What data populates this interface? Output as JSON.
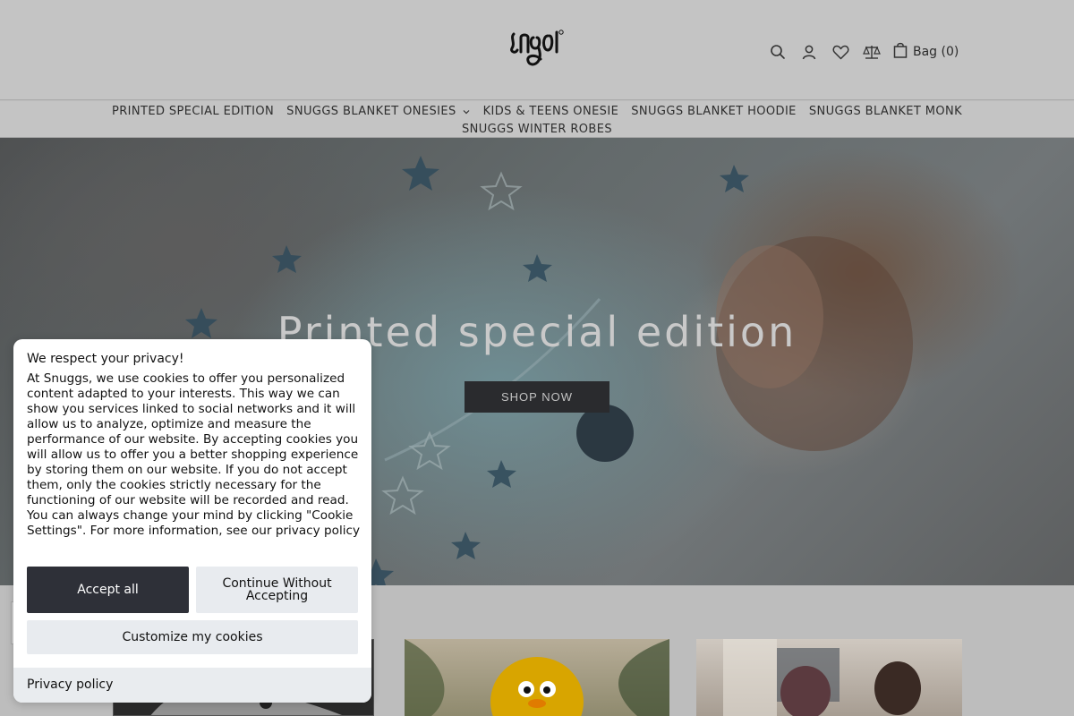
{
  "header": {
    "logo_text": "snugs",
    "bag_label": "Bag (0)",
    "icons": [
      "search-icon",
      "user-icon",
      "heart-icon",
      "compare-scale-icon",
      "shopping-bag-icon"
    ]
  },
  "nav": {
    "items": [
      {
        "label": "PRINTED SPECIAL EDITION"
      },
      {
        "label": "SNUGGS BLANKET ONESIES",
        "has_dropdown": true
      },
      {
        "label": "KIDS & TEENS ONESIE"
      },
      {
        "label": "SNUGGS BLANKET HOODIE"
      },
      {
        "label": "SNUGGS BLANKET MONK"
      },
      {
        "label": "SNUGGS WINTER ROBES"
      }
    ]
  },
  "hero": {
    "title": "Printed special edition",
    "cta": "SHOP NOW"
  },
  "cookie": {
    "title": "We respect your privacy!",
    "body": "At Snuggs, we use cookies to offer you personalized content adapted to your interests. This way we can show you services linked to social networks and it will allow us to analyze, optimize and measure the performance of our website. By accepting cookies you will allow us to offer you a better shopping experience by storing them on our website. If you do not accept them, only the cookies strictly necessary for the functioning of our website will be recorded and read. You can always change your mind by clicking \"Cookie Settings\". For more information, see our privacy policy",
    "accept_label": "Accept all",
    "continue_label": "Continue Without Accepting",
    "customize_label": "Customize my cookies",
    "privacy_label": "Privacy policy"
  },
  "colors": {
    "overlay": "#bdbdbd",
    "accept_bg": "#2e3038",
    "secondary_bg": "#e8ebef",
    "shop_btn_bg": "#2a2b2e"
  }
}
